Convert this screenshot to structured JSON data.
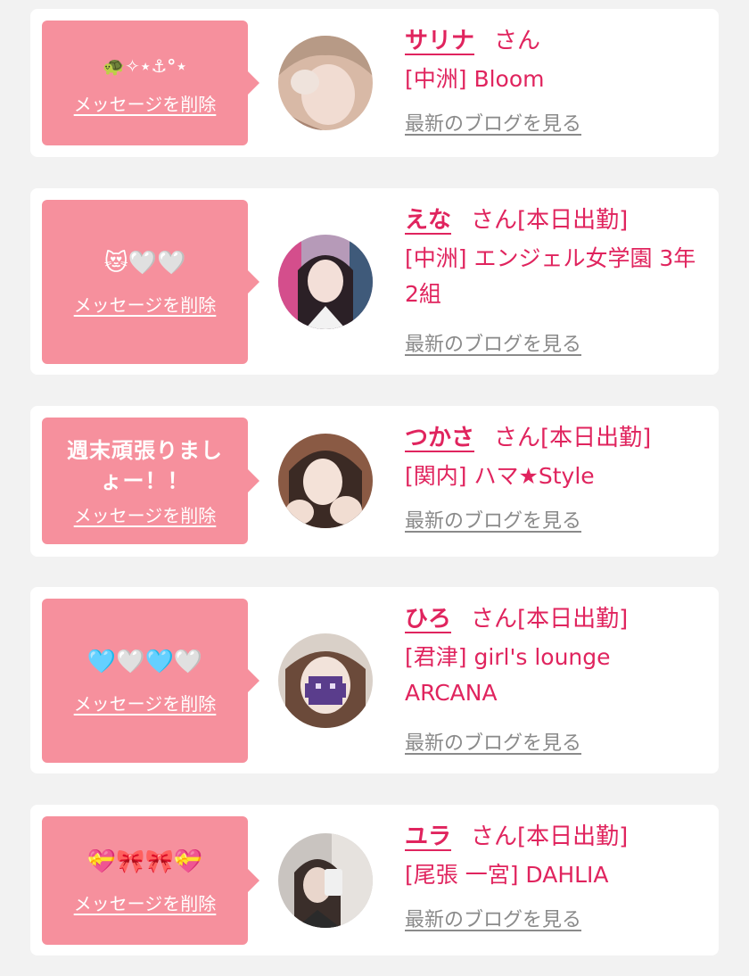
{
  "colors": {
    "accent": "#e0245e",
    "bubble": "#f6909d",
    "link_gray": "#8a8a8a",
    "background": "#f2f2f2"
  },
  "cards": [
    {
      "message": "🐢✧⋆⚓︎°⋆",
      "delete_label": "メッセージを削除",
      "name": "サリナ",
      "honorific": "さん",
      "status": "",
      "shop": "[中洲] Bloom",
      "blog_link": "最新のブログを見る",
      "avatar_icon": "avatar-photo-icon"
    },
    {
      "message": "😻🤍🤍",
      "delete_label": "メッセージを削除",
      "name": "えな",
      "honorific": "さん",
      "status": "[本日出勤]",
      "shop": "[中洲] エンジェル女学園 3年2組",
      "blog_link": "最新のブログを見る",
      "avatar_icon": "avatar-photo-icon"
    },
    {
      "message": "週末頑張りましょー！！",
      "delete_label": "メッセージを削除",
      "name": "つかさ",
      "honorific": "さん",
      "status": "[本日出勤]",
      "shop": "[関内] ハマ★Style",
      "blog_link": "最新のブログを見る",
      "avatar_icon": "avatar-photo-icon"
    },
    {
      "message": "🩵🤍🩵🤍",
      "delete_label": "メッセージを削除",
      "name": "ひろ",
      "honorific": "さん",
      "status": "[本日出勤]",
      "shop": "[君津] girl's lounge ARCANA",
      "blog_link": "最新のブログを見る",
      "avatar_icon": "avatar-photo-icon"
    },
    {
      "message": "💝🎀🎀💝",
      "delete_label": "メッセージを削除",
      "name": "ユラ",
      "honorific": "さん",
      "status": "[本日出勤]",
      "shop": "[尾張 一宮] DAHLIA",
      "blog_link": "最新のブログを見る",
      "avatar_icon": "avatar-photo-icon"
    }
  ]
}
